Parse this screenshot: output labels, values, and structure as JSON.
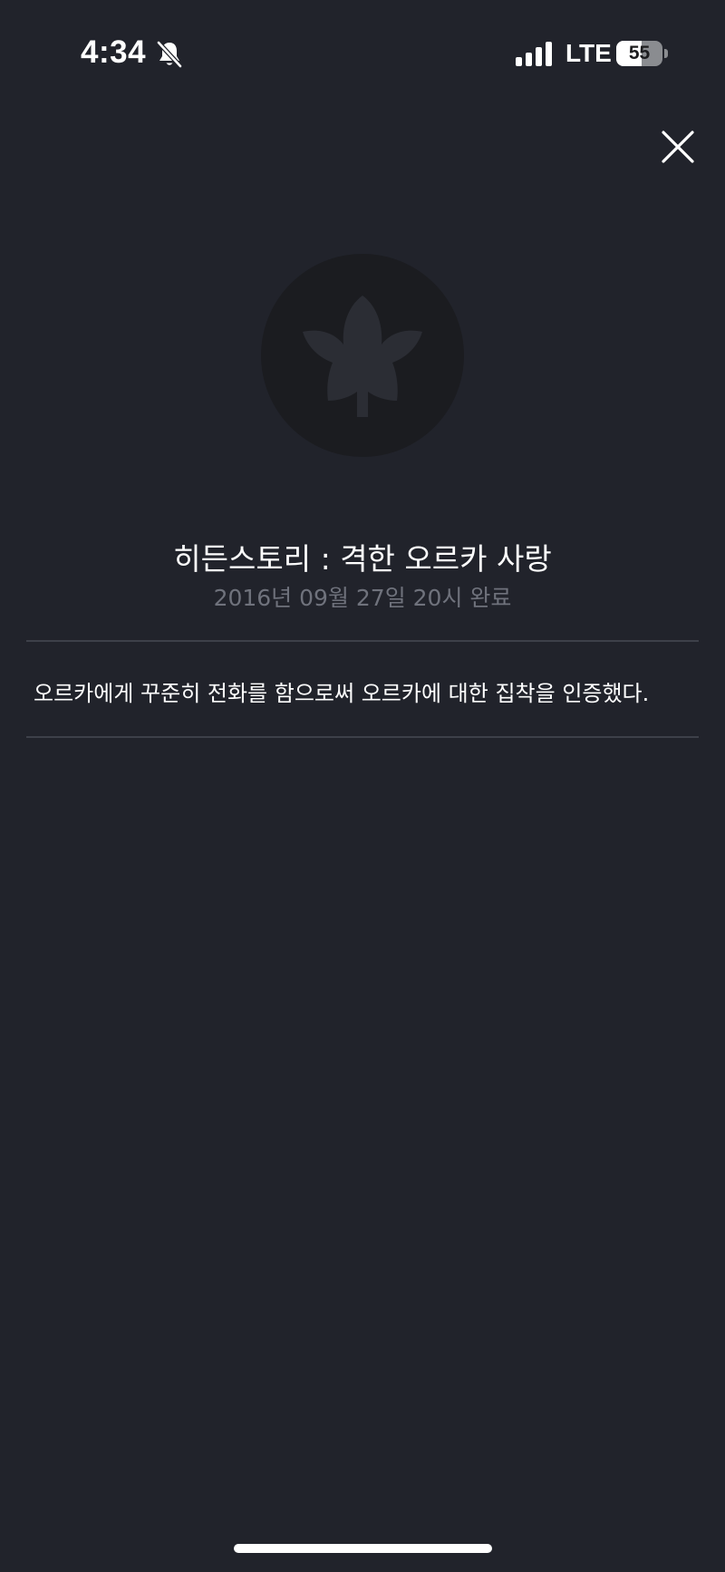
{
  "status_bar": {
    "time": "4:34",
    "network": "LTE",
    "battery_level": "55",
    "icons": {
      "silent_mode": "bell-slash-icon",
      "signal": "cellular-signal-icon",
      "battery": "battery-icon"
    }
  },
  "header": {
    "close_icon": "close-icon"
  },
  "achievement": {
    "badge_icon": "maple-leaf-icon",
    "title": "히든스토리 : 격한 오르카 사랑",
    "completed_at": "2016년 09월 27일 20시 완료",
    "description": "오르카에게 꾸준히 전화를 함으로써 오르카에 대한 집착을 인증했다."
  },
  "colors": {
    "background": "#21232b",
    "badge_circle": "#1b1c20",
    "badge_icon": "#2b2d34",
    "secondary_text": "#6f727c",
    "divider": "#3d4049"
  }
}
